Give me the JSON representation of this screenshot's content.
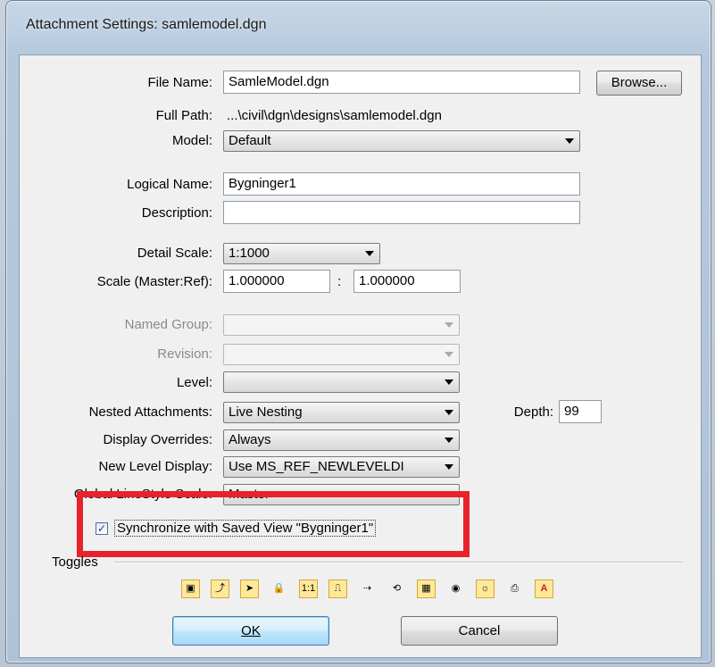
{
  "window": {
    "title": "Attachment Settings: samlemodel.dgn"
  },
  "labels": {
    "file_name": "File Name:",
    "full_path": "Full Path:",
    "model": "Model:",
    "logical_name": "Logical Name:",
    "description": "Description:",
    "detail_scale": "Detail Scale:",
    "scale": "Scale (Master:Ref):",
    "named_group": "Named Group:",
    "revision": "Revision:",
    "level": "Level:",
    "nested_attachments": "Nested Attachments:",
    "depth": "Depth:",
    "display_overrides": "Display Overrides:",
    "new_level_display": "New Level Display:",
    "global_linestyle_scale": "Global LineStyle Scale:",
    "toggles": "Toggles"
  },
  "fields": {
    "file_name": "SamleModel.dgn",
    "full_path": "...\\civil\\dgn\\designs\\samlemodel.dgn",
    "model": "Default",
    "logical_name": "Bygninger1",
    "description": "",
    "detail_scale": "1:1000",
    "scale_master": "1.000000",
    "scale_separator": ":",
    "scale_ref": "1.000000",
    "named_group": "",
    "revision": "",
    "level": "",
    "nested_attachments": "Live Nesting",
    "depth": "99",
    "display_overrides": "Always",
    "new_level_display": "Use MS_REF_NEWLEVELDI",
    "global_linestyle_scale": "Master"
  },
  "checkbox": {
    "label": "Synchronize with Saved View \"Bygninger1\"",
    "checked": true
  },
  "buttons": {
    "browse": "Browse...",
    "ok": "OK",
    "cancel": "Cancel"
  },
  "toggles": [
    {
      "icon": "display-toggle-icon",
      "on": true
    },
    {
      "icon": "snap-toggle-icon",
      "on": true
    },
    {
      "icon": "locate-toggle-icon",
      "on": true
    },
    {
      "icon": "clip-lock-icon",
      "on": false
    },
    {
      "icon": "scale-1to1-icon",
      "on": true
    },
    {
      "icon": "linestyle-scale-icon",
      "on": true
    },
    {
      "icon": "ignore-attachment-icon",
      "on": false
    },
    {
      "icon": "treat-as-element-icon",
      "on": false
    },
    {
      "icon": "raster-grid-icon",
      "on": true
    },
    {
      "icon": "display-raster-icon",
      "on": false
    },
    {
      "icon": "lights-icon",
      "on": true
    },
    {
      "icon": "print-icon",
      "on": false
    },
    {
      "icon": "text-annotation-icon",
      "on": true
    }
  ],
  "highlight_color": "#e8222a"
}
